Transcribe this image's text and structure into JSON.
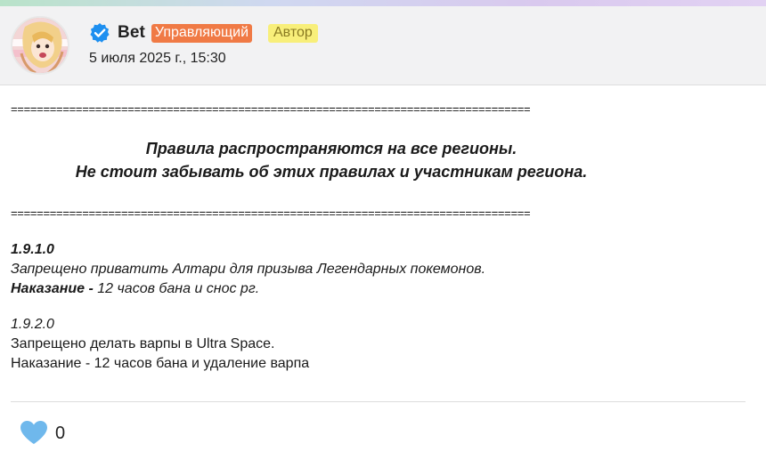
{
  "author": {
    "name": "Bet",
    "role_badge": "Управляющий",
    "author_badge": "Автор",
    "date": "5 июля 2025 г., 15:30"
  },
  "post": {
    "divider": "================================================================================",
    "headline_1": "Правила распространяются на все регионы.",
    "headline_2": "Не стоит забывать об этих правилах и участникам региона.",
    "rules": [
      {
        "number": "1.9.1.0",
        "text": "Запрещено приватить Алтари для призыва Легендарных покемонов.",
        "penalty_label": "Наказание -",
        "penalty_text": " 12 часов бана и снос рг."
      },
      {
        "number": "1.9.2.0",
        "text": "Запрещено делать варпы в Ultra Space.",
        "penalty_text": "Наказание - 12 часов бана и удаление варпа"
      }
    ]
  },
  "reactions": {
    "like_count": "0"
  },
  "colors": {
    "role_badge_bg": "#f07a45",
    "author_badge_bg": "#f8ef7a",
    "verified_blue": "#1d8ff0",
    "like_heart": "#6fb8ec"
  }
}
